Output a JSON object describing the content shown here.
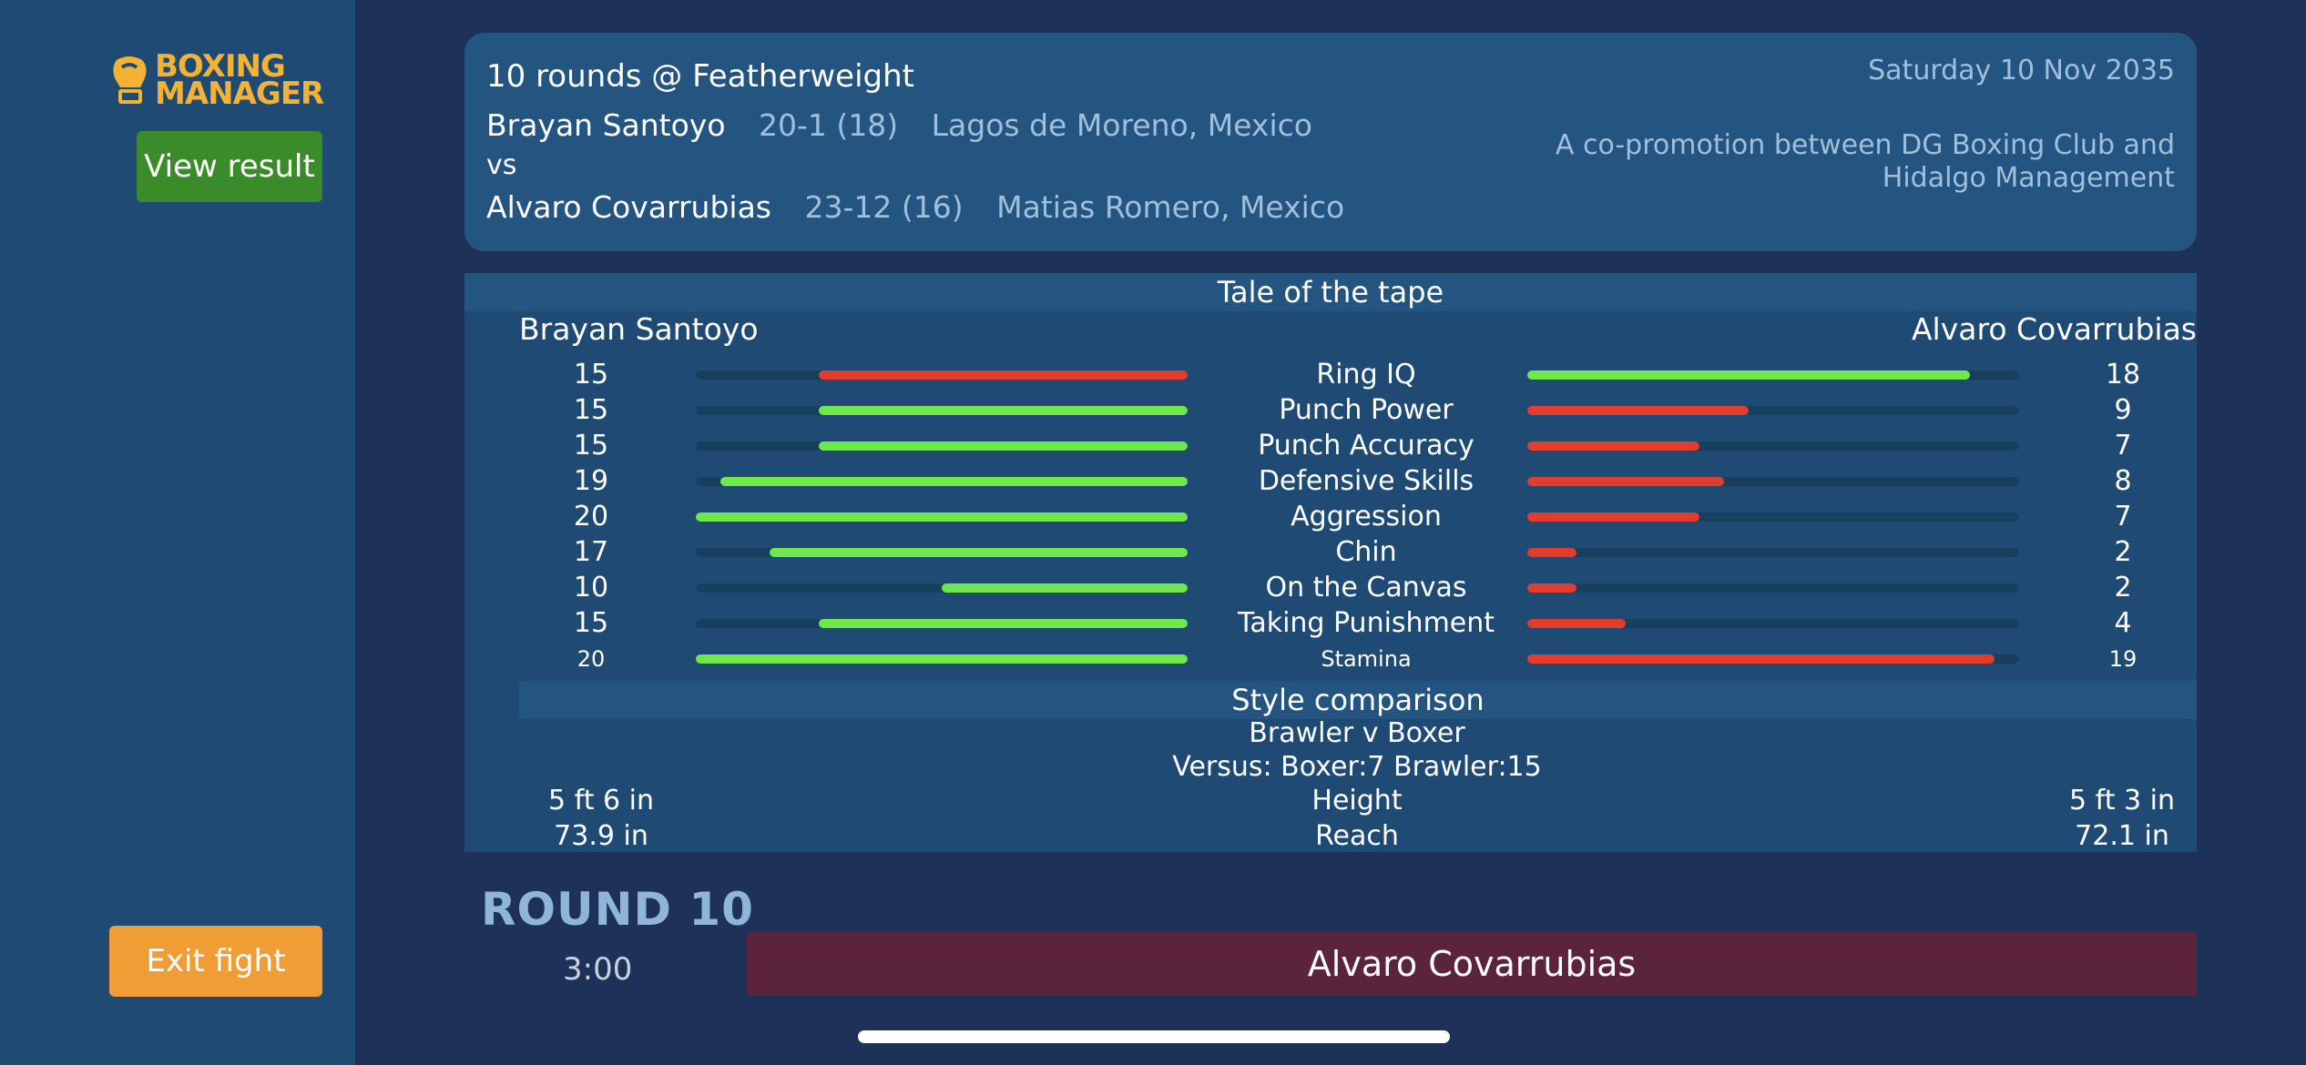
{
  "sidebar": {
    "logo_line1": "BOXING",
    "logo_line2": "MANAGER",
    "view_result_label": "View result",
    "exit_fight_label": "Exit fight"
  },
  "header": {
    "title": "10 rounds @ Featherweight",
    "date": "Saturday 10 Nov 2035",
    "promo": "A co-promotion between DG Boxing Club and Hidalgo Management",
    "fighter1": {
      "name": "Brayan Santoyo",
      "record": "20-1 (18)",
      "hometown": "Lagos de Moreno, Mexico"
    },
    "vs": "vs",
    "fighter2": {
      "name": "Alvaro Covarrubias",
      "record": "23-12 (16)",
      "hometown": "Matias Romero, Mexico"
    }
  },
  "tape": {
    "title": "Tale of the tape",
    "left_name": "Brayan Santoyo",
    "right_name": "Alvaro Covarrubias",
    "max": 20,
    "stats": [
      {
        "label": "Ring IQ",
        "left": "15",
        "right": "18",
        "left_color": "#e23d2c",
        "right_color": "#6ee84a"
      },
      {
        "label": "Punch Power",
        "left": "15",
        "right": "9",
        "left_color": "#6ee84a",
        "right_color": "#e23d2c"
      },
      {
        "label": "Punch Accuracy",
        "left": "15",
        "right": "7",
        "left_color": "#6ee84a",
        "right_color": "#e23d2c"
      },
      {
        "label": "Defensive Skills",
        "left": "19",
        "right": "8",
        "left_color": "#6ee84a",
        "right_color": "#e23d2c"
      },
      {
        "label": "Aggression",
        "left": "20",
        "right": "7",
        "left_color": "#6ee84a",
        "right_color": "#e23d2c"
      },
      {
        "label": "Chin",
        "left": "17",
        "right": "2",
        "left_color": "#6ee84a",
        "right_color": "#e23d2c"
      },
      {
        "label": "On the Canvas",
        "left": "10",
        "right": "2",
        "left_color": "#6ee84a",
        "right_color": "#e23d2c"
      },
      {
        "label": "Taking Punishment",
        "left": "15",
        "right": "4",
        "left_color": "#6ee84a",
        "right_color": "#e23d2c"
      },
      {
        "label": "Stamina",
        "left": "20",
        "right": "19",
        "left_color": "#6ee84a",
        "right_color": "#e23d2c"
      }
    ],
    "style_title": "Style comparison",
    "style_matchup": "Brawler v Boxer",
    "style_versus": "Versus: Boxer:7   Brawler:15",
    "height_label": "Height",
    "height_left": "5 ft 6 in",
    "height_right": "5 ft 3 in",
    "reach_label": "Reach",
    "reach_left": "73.9 in",
    "reach_right": "72.1 in"
  },
  "fight": {
    "round_label": "ROUND 10",
    "clock": "3:00",
    "active_fighter": "Alvaro Covarrubias"
  }
}
